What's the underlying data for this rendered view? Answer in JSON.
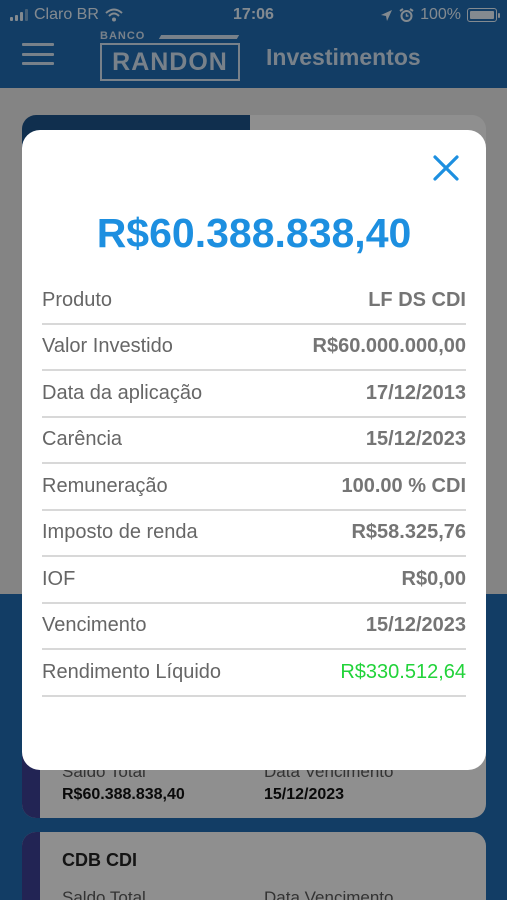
{
  "status_bar": {
    "carrier": "Claro BR",
    "time": "17:06",
    "battery": "100%",
    "icons": [
      "signal-icon",
      "wifi-icon",
      "location-icon",
      "alarm-icon",
      "battery-icon"
    ]
  },
  "nav": {
    "logo_small": "BANCO",
    "logo_main": "RANDON",
    "title": "Investimentos",
    "menu_icon": "hamburger-icon"
  },
  "background_cards": [
    {
      "saldo_label": "Saldo Total",
      "saldo_value": "R$60.388.838,40",
      "vencimento_label": "Data Vencimento",
      "vencimento_value": "15/12/2023"
    },
    {
      "name": "CDB CDI",
      "saldo_label": "Saldo Total",
      "vencimento_label": "Data Vencimento"
    }
  ],
  "modal": {
    "close_icon": "close-icon",
    "amount": "R$60.388.838,40",
    "rows": [
      {
        "label": "Produto",
        "value": "LF DS CDI"
      },
      {
        "label": "Valor Investido",
        "value": "R$60.000.000,00"
      },
      {
        "label": "Data da aplicação",
        "value": "17/12/2013"
      },
      {
        "label": "Carência",
        "value": "15/12/2023"
      },
      {
        "label": "Remuneração",
        "value": "100.00 % CDI"
      },
      {
        "label": "Imposto de renda",
        "value": "R$58.325,76"
      },
      {
        "label": "IOF",
        "value": "R$0,00"
      },
      {
        "label": "Vencimento",
        "value": "15/12/2023"
      },
      {
        "label": "Rendimento Líquido",
        "value": "R$330.512,64"
      }
    ]
  },
  "colors": {
    "brand_blue": "#1f66a8",
    "amount_blue": "#1d8fe0",
    "positive_green": "#22d33a"
  }
}
